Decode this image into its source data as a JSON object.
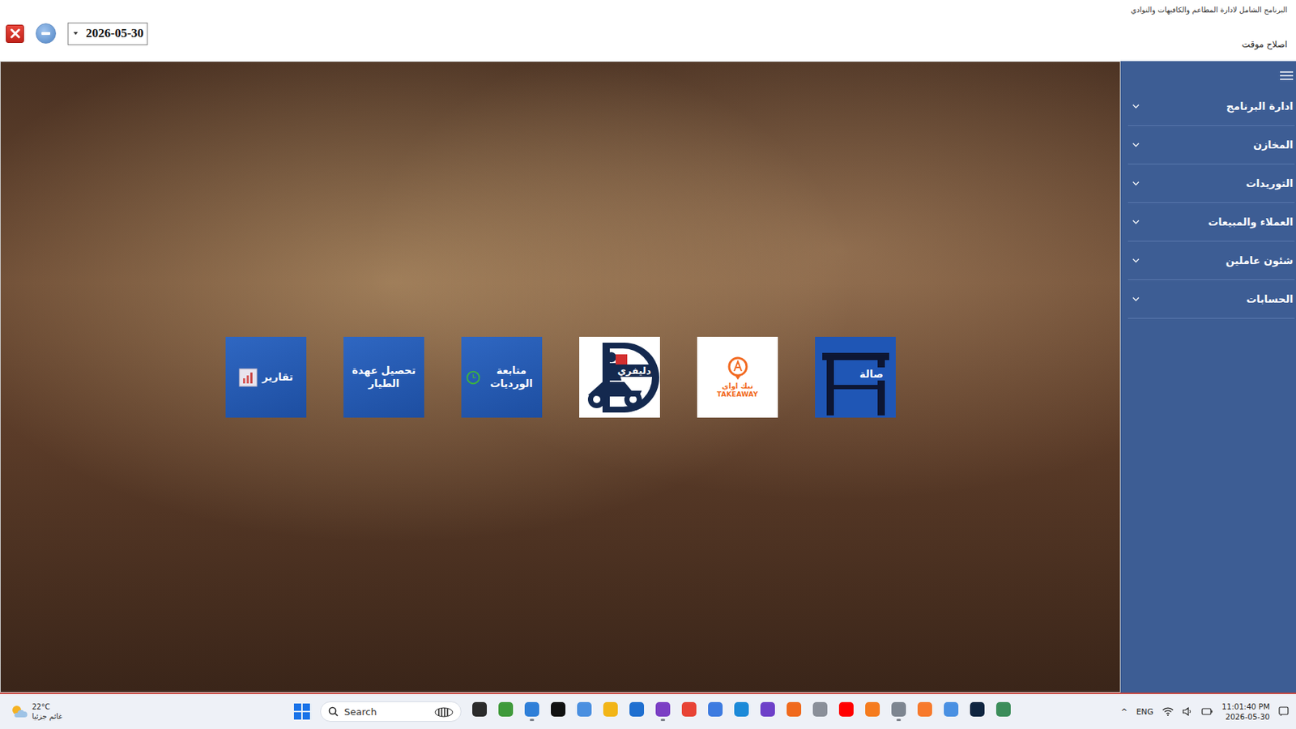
{
  "window": {
    "title": "البرنامج الشامل لادارة المطاعم والكافيهات والنوادي",
    "subtitle": "اصلاح موقت",
    "date": "2026-05-30"
  },
  "sidebar": {
    "items": [
      {
        "label": "ادارة البرنامج",
        "expanded": false
      },
      {
        "label": "المخازن",
        "expanded": false
      },
      {
        "label": "التوريدات",
        "expanded": false
      },
      {
        "label": "العملاء والمبيعات",
        "expanded": false
      },
      {
        "label": "شئون عاملين",
        "expanded": false
      },
      {
        "label": "الحسابات",
        "expanded": false
      }
    ]
  },
  "tiles": [
    {
      "label": "تقارير",
      "kind": "reports"
    },
    {
      "label": "تحصيل عهدة الطيار",
      "kind": "custody"
    },
    {
      "label": "متابعة الورديات",
      "kind": "shifts"
    },
    {
      "label": "دليفري",
      "kind": "delivery"
    },
    {
      "label": "تيك اواي",
      "sublabel": "TAKEAWAY",
      "kind": "takeaway"
    },
    {
      "label": "صالة",
      "kind": "hall"
    }
  ],
  "taskbar": {
    "weather": {
      "temperature": "22°C",
      "condition": "غائم جزئيا"
    },
    "search": {
      "placeholder": "Search"
    },
    "apps": [
      {
        "name": "task-view",
        "color": "#2b2b2b",
        "open": false
      },
      {
        "name": "charts",
        "color": "#3f9a3a",
        "open": false
      },
      {
        "name": "snipping",
        "color": "#2f7fd8",
        "open": true
      },
      {
        "name": "w-app",
        "color": "#111111",
        "open": false
      },
      {
        "name": "copilot",
        "color": "#4a8fe0",
        "open": false
      },
      {
        "name": "explorer",
        "color": "#f2b517",
        "open": false
      },
      {
        "name": "store",
        "color": "#1f6fd0",
        "open": false
      },
      {
        "name": "visual-studio",
        "color": "#7b3fc4",
        "open": true
      },
      {
        "name": "chrome",
        "color": "#e84335",
        "open": false
      },
      {
        "name": "a-app",
        "color": "#3d7be0",
        "open": false
      },
      {
        "name": "vscode",
        "color": "#1c8ad8",
        "open": false
      },
      {
        "name": "github",
        "color": "#6e40c9",
        "open": false
      },
      {
        "name": "firefox",
        "color": "#f06a1d",
        "open": false
      },
      {
        "name": "photos",
        "color": "#8a8f99",
        "open": false
      },
      {
        "name": "youtube",
        "color": "#ff0000",
        "open": false
      },
      {
        "name": "orange-app",
        "color": "#f57c1f",
        "open": false
      },
      {
        "name": "tool-app",
        "color": "#7d8590",
        "open": true
      },
      {
        "name": "sublime",
        "color": "#f77a2c",
        "open": false
      },
      {
        "name": "a-light",
        "color": "#4a90e2",
        "open": false
      },
      {
        "name": "a-dark",
        "color": "#0f2540",
        "open": false
      },
      {
        "name": "screen-app",
        "color": "#3c8d5a",
        "open": false
      }
    ],
    "tray": {
      "overflow": "^",
      "language": "ENG",
      "time": "11:01:40 PM",
      "date": "2026-05-30"
    }
  }
}
